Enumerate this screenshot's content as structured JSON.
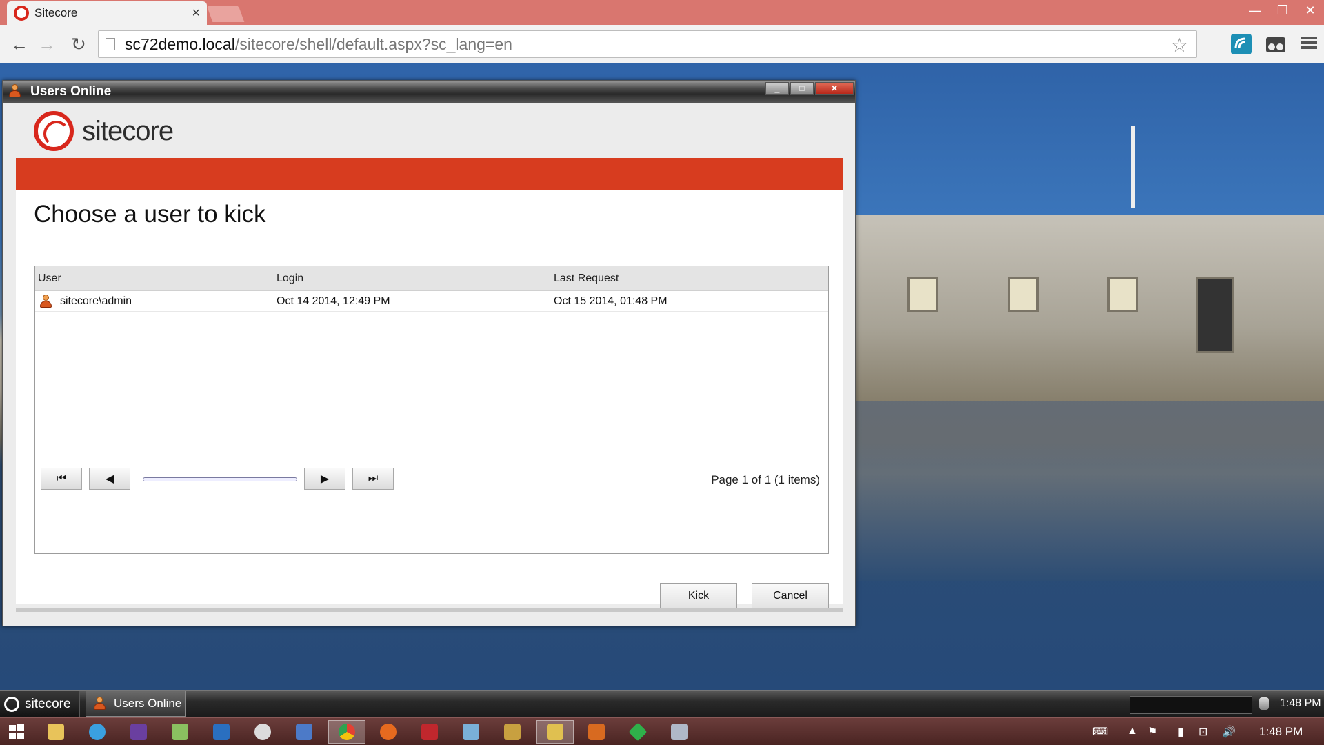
{
  "browser": {
    "tab_title": "Sitecore",
    "url_host": "sc72demo.local",
    "url_path": "/sitecore/shell/default.aspx?sc_lang=en"
  },
  "dialog": {
    "window_title": "Users Online",
    "logo_text": "sitecore",
    "heading": "Choose a user to kick",
    "columns": [
      "User",
      "Login",
      "Last Request"
    ],
    "rows": [
      {
        "user": "sitecore\\admin",
        "login": "Oct 14 2014, 12:49 PM",
        "last_request": "Oct 15 2014, 01:48 PM"
      }
    ],
    "pager": {
      "first": "⏮",
      "prev": "◀",
      "next": "▶",
      "last": "⏭",
      "info": "Page 1 of 1 (1 items)"
    },
    "kick_label": "Kick",
    "cancel_label": "Cancel"
  },
  "sitecore_taskbar": {
    "start_label": "sitecore",
    "task_label": "Users Online",
    "clock": "1:48 PM"
  },
  "windows_taskbar": {
    "clock": "1:48 PM"
  },
  "colors": {
    "sitecore_red": "#d73c1f",
    "chrome_frame": "#d9766f",
    "windows_taskbar": "#4a2422"
  }
}
